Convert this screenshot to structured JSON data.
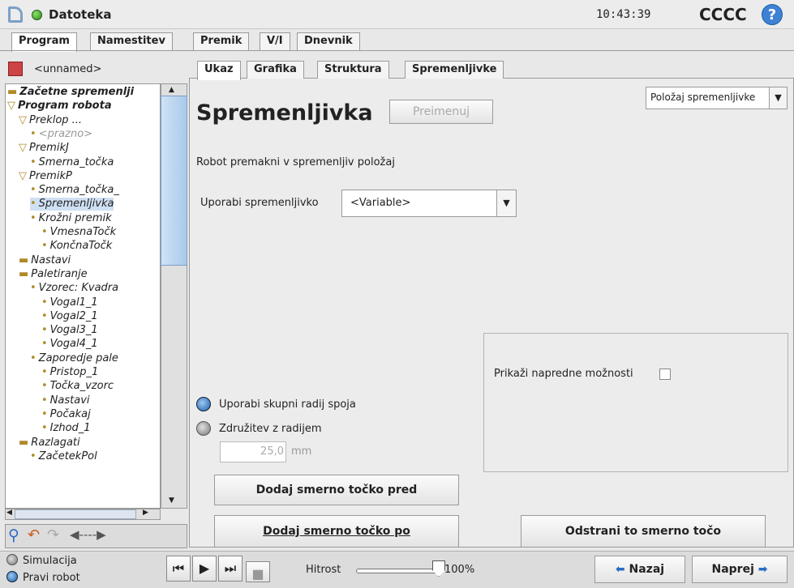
{
  "titlebar": {
    "app_title": "Datoteka",
    "time": "10:43:39",
    "robot_name": "CCCC",
    "help_glyph": "?"
  },
  "top_tabs": [
    "Program",
    "Namestitev",
    "Premik",
    "V/I",
    "Dnevnik"
  ],
  "sub_tabs": [
    "Ukaz",
    "Grafika",
    "Struktura",
    "Spremenljivke"
  ],
  "file": {
    "name": "<unnamed>"
  },
  "tree": [
    {
      "label": "Začetne spremenlji",
      "level": 0,
      "bold": true
    },
    {
      "label": "Program robota",
      "level": 0,
      "bold": true
    },
    {
      "label": "Preklop ...",
      "level": 1
    },
    {
      "label": "<prazno>",
      "level": 2,
      "dim": true
    },
    {
      "label": "PremikJ",
      "level": 1
    },
    {
      "label": "Smerna_točka",
      "level": 2
    },
    {
      "label": "PremikP",
      "level": 1
    },
    {
      "label": "Smerna_točka_",
      "level": 2
    },
    {
      "label": "Spremenljivka",
      "level": 2,
      "selected": true
    },
    {
      "label": "Krožni premik",
      "level": 2
    },
    {
      "label": "VmesnaTočk",
      "level": 3
    },
    {
      "label": "KončnaTočk",
      "level": 3
    },
    {
      "label": "Nastavi",
      "level": 1
    },
    {
      "label": "Paletiranje",
      "level": 1
    },
    {
      "label": "Vzorec: Kvadra",
      "level": 2
    },
    {
      "label": "Vogal1_1",
      "level": 3
    },
    {
      "label": "Vogal2_1",
      "level": 3
    },
    {
      "label": "Vogal3_1",
      "level": 3
    },
    {
      "label": "Vogal4_1",
      "level": 3
    },
    {
      "label": "Zaporedje pale",
      "level": 2
    },
    {
      "label": "Pristop_1",
      "level": 3
    },
    {
      "label": "Točka_vzorc",
      "level": 3
    },
    {
      "label": "Nastavi",
      "level": 3
    },
    {
      "label": "Počakaj",
      "level": 3
    },
    {
      "label": "Izhod_1",
      "level": 3
    },
    {
      "label": "Razlagati",
      "level": 1
    },
    {
      "label": "ZačetekPol",
      "level": 2
    }
  ],
  "main": {
    "heading": "Spremenljivka",
    "rename_label": "Preimenuj",
    "position_select": "Položaj spremenljivke",
    "description": "Robot premakni v spremenljiv položaj",
    "use_variable_label": "Uporabi spremenljivko",
    "variable_value": "<Variable>",
    "advanced_label": "Prikaži napredne možnosti",
    "radio_shared": "Uporabi skupni radij spoja",
    "radio_blend": "Združitev z radijem",
    "radius_value": "25,0",
    "radius_unit": "mm",
    "add_before": "Dodaj smerno točko pred",
    "add_after": "Dodaj smerno točko po",
    "remove": "Odstrani to smerno točo"
  },
  "bottom": {
    "simulation": "Simulacija",
    "real_robot": "Pravi robot",
    "speed_label": "Hitrost",
    "speed_value": "100%",
    "speed_fraction": 1.0,
    "back": "Nazaj",
    "next": "Naprej"
  }
}
